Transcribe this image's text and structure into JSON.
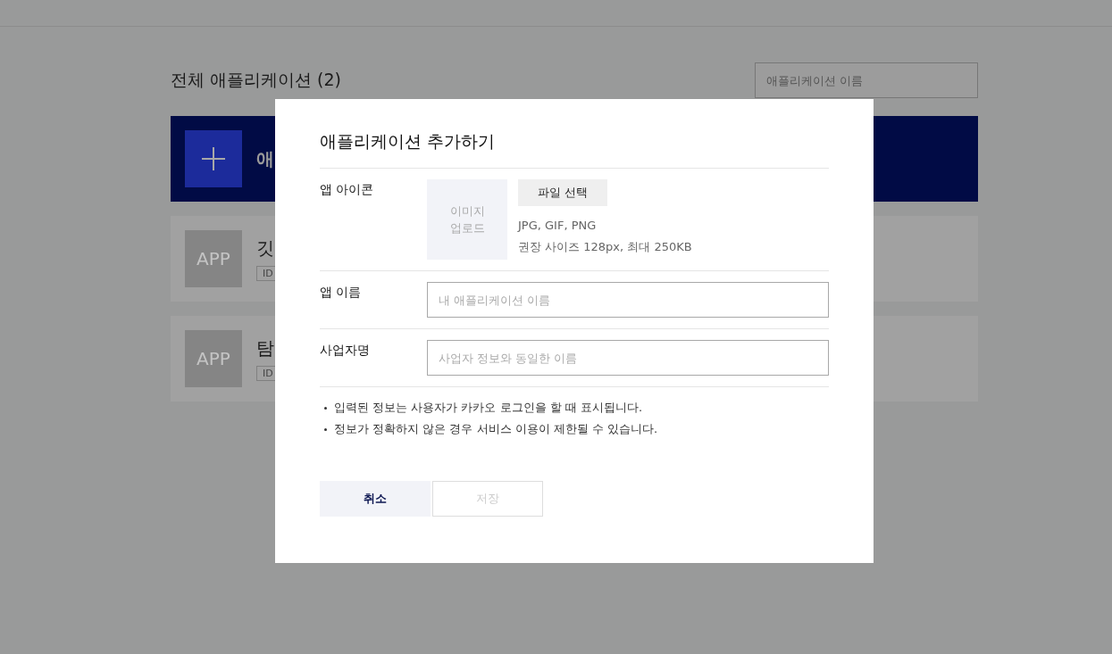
{
  "page": {
    "title": "전체 애플리케이션 (2)",
    "search": {
      "placeholder": "애플리케이션 이름"
    },
    "add_card": {
      "label": "애"
    },
    "apps": [
      {
        "icon_text": "APP",
        "name": "깃",
        "badge": "ID"
      },
      {
        "icon_text": "APP",
        "name": "탐",
        "badge": "ID"
      }
    ]
  },
  "modal": {
    "title": "애플리케이션 추가하기",
    "rows": [
      {
        "kind": "icon",
        "label": "앱 아이콘",
        "upload_box": "이미지 업로드",
        "file_button": "파일 선택",
        "hints": [
          "JPG, GIF, PNG",
          "권장 사이즈 128px, 최대 250KB"
        ]
      },
      {
        "kind": "input",
        "label": "앱 이름",
        "placeholder": "내 애플리케이션 이름"
      },
      {
        "kind": "input",
        "label": "사업자명",
        "placeholder": "사업자 정보와 동일한 이름"
      }
    ],
    "notes": [
      "입력된 정보는 사용자가 카카오 로그인을 할 때 표시됩니다.",
      "정보가 정확하지 않은 경우 서비스 이용이 제한될 수 있습니다."
    ],
    "buttons": [
      {
        "label": "취소",
        "disabled": false
      },
      {
        "label": "저장",
        "disabled": true
      }
    ]
  }
}
